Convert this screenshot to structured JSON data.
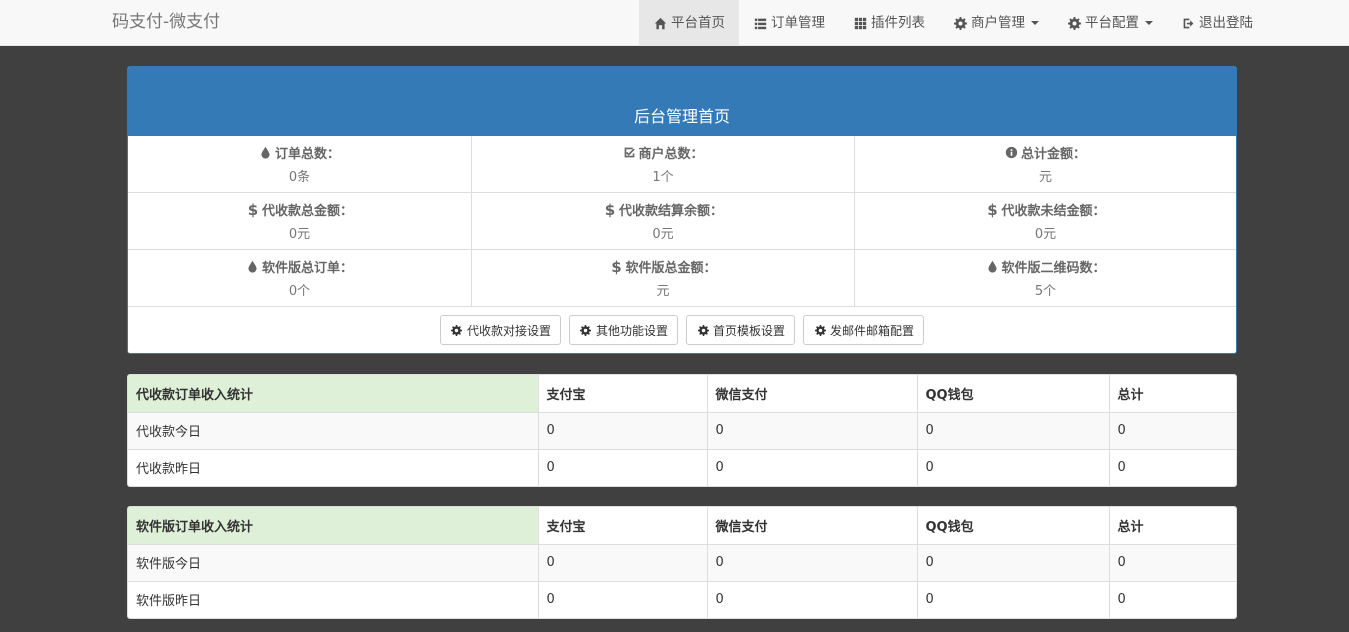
{
  "brand": "码支付-微支付",
  "nav": [
    {
      "label": "平台首页",
      "icon": "home-icon",
      "active": true
    },
    {
      "label": "订单管理",
      "icon": "list-icon"
    },
    {
      "label": "插件列表",
      "icon": "grid-icon"
    },
    {
      "label": "商户管理",
      "icon": "gear-icon",
      "dropdown": true
    },
    {
      "label": "平台配置",
      "icon": "gear-icon",
      "dropdown": true
    },
    {
      "label": "退出登陆",
      "icon": "logout-icon"
    }
  ],
  "panel": {
    "title": "后台管理首页",
    "stats": [
      {
        "label": "订单总数：",
        "value": "0条",
        "icon": "droplet-icon"
      },
      {
        "label": "商户总数：",
        "value": "1个",
        "icon": "checkbox-icon"
      },
      {
        "label": "总计金额：",
        "value": "元",
        "icon": "info-icon"
      },
      {
        "label": "代收款总金额：",
        "value": "0元",
        "icon": "dollar-icon"
      },
      {
        "label": "代收款结算余额：",
        "value": "0元",
        "icon": "dollar-icon"
      },
      {
        "label": "代收款未结金额：",
        "value": "0元",
        "icon": "dollar-icon"
      },
      {
        "label": "软件版总订单：",
        "value": "0个",
        "icon": "droplet-icon"
      },
      {
        "label": "软件版总金额：",
        "value": "元",
        "icon": "dollar-icon"
      },
      {
        "label": "软件版二维码数：",
        "value": "5个",
        "icon": "droplet-icon"
      }
    ],
    "buttons": [
      "代收款对接设置",
      "其他功能设置",
      "首页模板设置",
      "发邮件邮箱配置"
    ]
  },
  "tables": [
    {
      "headers": [
        "代收款订单收入统计",
        "支付宝",
        "微信支付",
        "QQ钱包",
        "总计"
      ],
      "rows": [
        [
          "代收款今日",
          "0",
          "0",
          "0",
          "0"
        ],
        [
          "代收款昨日",
          "0",
          "0",
          "0",
          "0"
        ]
      ]
    },
    {
      "headers": [
        "软件版订单收入统计",
        "支付宝",
        "微信支付",
        "QQ钱包",
        "总计"
      ],
      "rows": [
        [
          "软件版今日",
          "0",
          "0",
          "0",
          "0"
        ],
        [
          "软件版昨日",
          "0",
          "0",
          "0",
          "0"
        ]
      ]
    }
  ]
}
